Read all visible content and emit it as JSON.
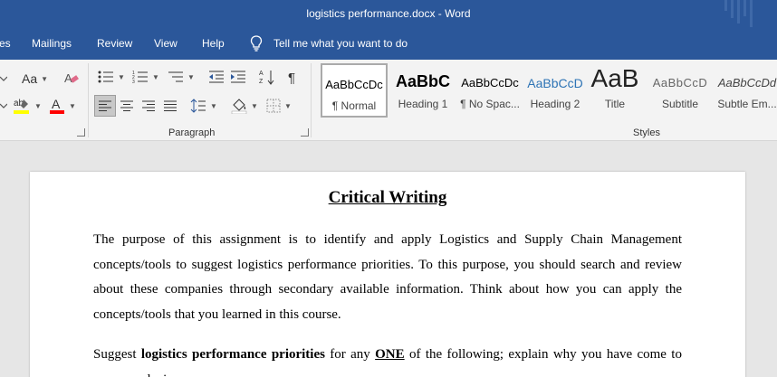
{
  "window": {
    "title": "logistics performance.docx  -  Word"
  },
  "menu": {
    "tabs": [
      "es",
      "Mailings",
      "Review",
      "View",
      "Help"
    ],
    "tell_me": "Tell me what you want to do"
  },
  "ribbon": {
    "font_group": {
      "change_case": "Aa"
    },
    "paragraph_group": {
      "label": "Paragraph"
    },
    "styles_group": {
      "label": "Styles",
      "items": [
        {
          "sample": "AaBbCcDc",
          "name": "¶ Normal"
        },
        {
          "sample": "AaBbC",
          "name": "Heading 1"
        },
        {
          "sample": "AaBbCcDc",
          "name": "¶ No Spac..."
        },
        {
          "sample": "AaBbCcD",
          "name": "Heading 2"
        },
        {
          "sample": "AaB",
          "name": "Title"
        },
        {
          "sample": "AaBbCcD",
          "name": "Subtitle"
        },
        {
          "sample": "AaBbCcDd",
          "name": "Subtle Em..."
        }
      ]
    }
  },
  "document": {
    "title": "Critical Writing",
    "paragraph1": "The purpose of this assignment is to identify and apply Logistics and Supply Chain Management concepts/tools to suggest logistics performance priorities. To this purpose, you should search and review about these companies through secondary available information. Think about how you can apply the concepts/tools that you learned in this course.",
    "paragraph2": {
      "prefix": "Suggest ",
      "bold": "logistics performance priorities",
      "middle": " for any ",
      "underline": "ONE",
      "suffix": " of the following; explain why you have come to your conclusion:"
    }
  },
  "colors": {
    "accent": "#2b579a",
    "ribbon_bg": "#f3f3f3",
    "canvas_bg": "#e6e6e6",
    "heading_blue": "#2e74b5",
    "highlight_yellow": "#ffff00",
    "font_color_red": "#ff0000"
  }
}
